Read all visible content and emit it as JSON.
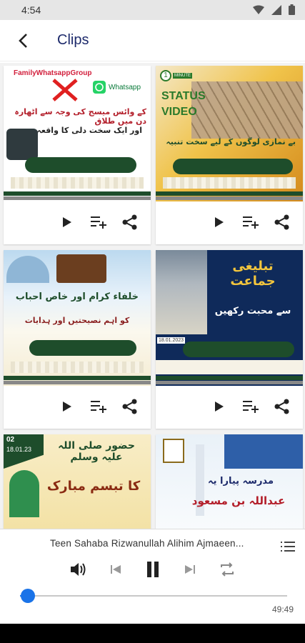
{
  "status": {
    "time": "4:54"
  },
  "header": {
    "title": "Clips"
  },
  "clips": [
    {
      "top_label": "FamilyWhatsappGroup",
      "badge": "Whatsapp",
      "line1": "کے وائس میسج کی وجہ سے اٹھارہ دن میں طلاق",
      "line2": "اور ایک سخت دلی کا واقعہ"
    },
    {
      "badge_number": "1",
      "badge_unit": "MINUTE",
      "status_line1": "STATUS",
      "status_line2": "VIDEO",
      "line1": "بے نمازی لوگوں کے لیے سخت تنبیہ"
    },
    {
      "line1": "خلفاء کرام اور خاص احباب",
      "line2": "کو اہم نصیحتیں اور ہدایات"
    },
    {
      "line1": "تبلیغی جماعت",
      "line2": "سے محبت رکھیں",
      "date": "18.01.2023"
    },
    {
      "tag": "02",
      "date": "18.01.23",
      "line1": "حضور صلی اللہ علیہ وسلم",
      "line2": "کا تبسم مبارک"
    },
    {
      "line1": "مدرسہ پیارا یہ",
      "line2": "عبداللہ بن مسعود"
    }
  ],
  "player": {
    "now_playing": "Teen Sahaba Rizwanullah Alihim Ajmaeen...",
    "duration": "49:49",
    "progress": 0.03
  },
  "colors": {
    "accent": "#1a73e8",
    "title": "#1d2a6b",
    "banner_green": "#1e4d2b"
  }
}
